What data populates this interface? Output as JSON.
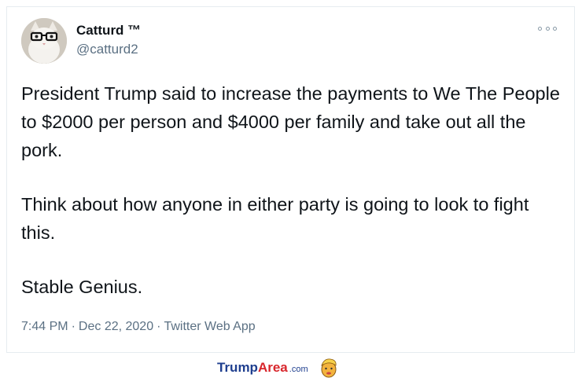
{
  "tweet": {
    "display_name": "Catturd ™",
    "handle": "@catturd2",
    "paragraphs": [
      "President Trump said to increase the payments to We The People to $2000 per person and $4000 per family and take out all the pork.",
      "Think about how anyone in either party is going to look to fight this.",
      "Stable Genius."
    ],
    "time": "7:44 PM",
    "date": "Dec 22, 2020",
    "separator": "·",
    "source_app": "Twitter Web App"
  },
  "watermark": {
    "brand_part1": "Trump",
    "brand_part2": "Area",
    "brand_suffix": ".com"
  },
  "icons": {
    "more": "more-options-icon",
    "avatar": "cat-avatar",
    "logo": "cartoon-face-icon"
  },
  "colors": {
    "text": "#0f1419",
    "muted": "#5b7083",
    "border": "#e6ecf0",
    "brand_blue": "#1f3f8f",
    "brand_red": "#d8262c"
  }
}
